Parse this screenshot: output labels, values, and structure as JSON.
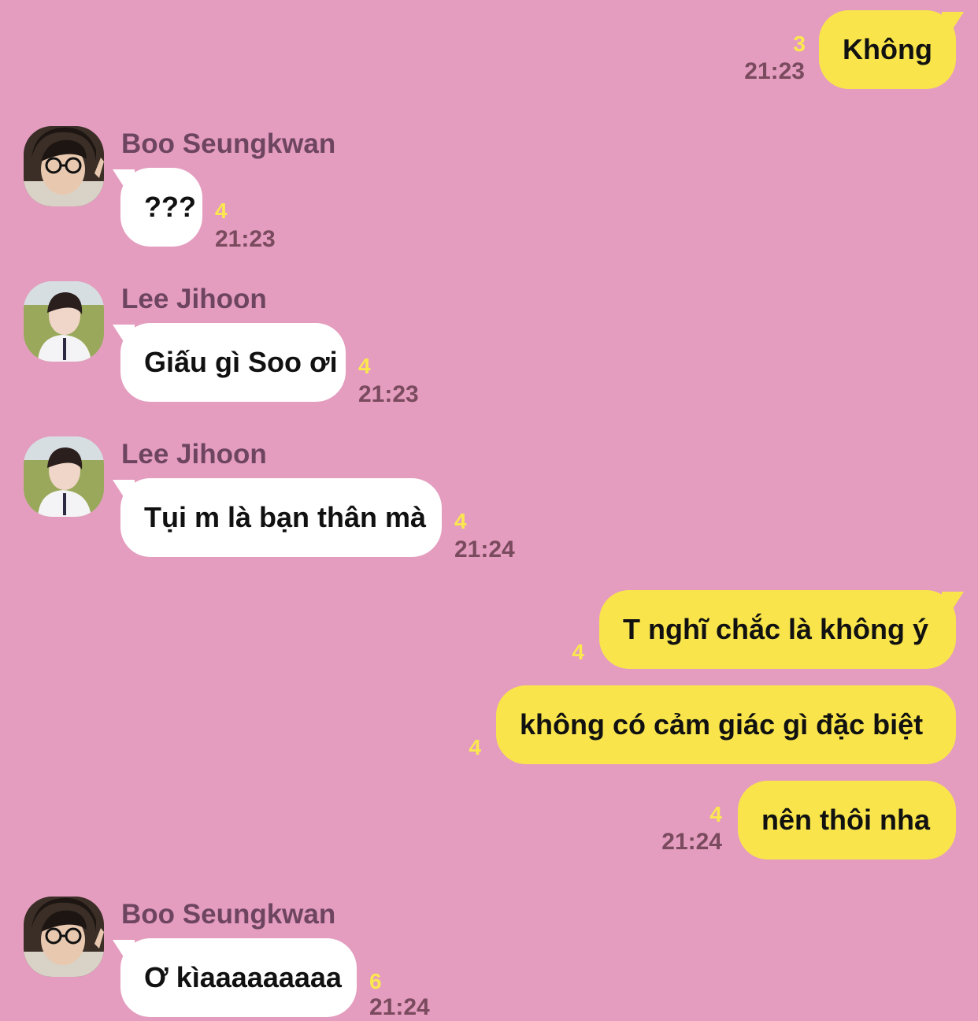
{
  "colors": {
    "background": "#e49dbf",
    "my_bubble": "#f9e54b",
    "their_bubble": "#ffffff",
    "unread": "#fbe74f",
    "meta": "#7a4a5e"
  },
  "messages": [
    {
      "text": "Không",
      "unread": "3",
      "time": "21:23"
    },
    {
      "sender": "Boo Seungkwan",
      "text": "???",
      "unread": "4",
      "time": "21:23"
    },
    {
      "sender": "Lee Jihoon",
      "text": "Giấu gì Soo ơi",
      "unread": "4",
      "time": "21:23"
    },
    {
      "sender": "Lee Jihoon",
      "text": "Tụi m là bạn thân mà",
      "unread": "4",
      "time": "21:24"
    },
    {
      "text": "T nghĩ chắc là không ý",
      "unread": "4"
    },
    {
      "text": "không có cảm giác gì đặc biệt",
      "unread": "4"
    },
    {
      "text": "nên thôi nha",
      "unread": "4",
      "time": "21:24"
    },
    {
      "sender": "Boo Seungkwan",
      "text": "Ơ kìaaaaaaaaa",
      "unread": "6",
      "time": "21:24"
    }
  ]
}
